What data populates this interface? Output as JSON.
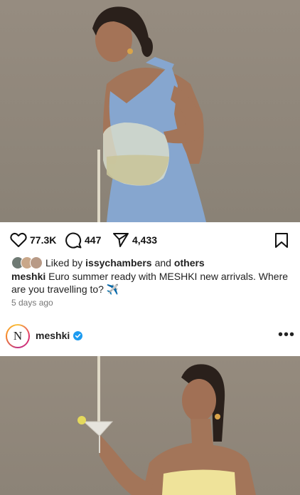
{
  "post_top": {
    "image_alt": "Model in blue halter dress pouring drink from a glass vase",
    "likes": "77.3K",
    "comments": "447",
    "shares": "4,433",
    "icons": {
      "like": "heart-icon",
      "comment": "comment-icon",
      "share": "send-icon",
      "save": "bookmark-icon"
    },
    "liked_prefix": "Liked by",
    "liked_user": "issychambers",
    "liked_and": "and",
    "liked_others": "others",
    "caption_user": "meshki",
    "caption_text": "Euro summer ready with MESHKI new arrivals. Where are you travelling to? ✈️",
    "time_ago": "5 days ago"
  },
  "post_bottom": {
    "avatar_letter": "N",
    "username": "meshki",
    "more_label": "•••",
    "image_alt": "Model in yellow strapless top holding a martini glass"
  },
  "colors": {
    "background_photo": "#8d8579",
    "dress_blue": "#86a6cf",
    "top_yellow": "#efe39a",
    "verified_blue": "#1d9bf0"
  }
}
